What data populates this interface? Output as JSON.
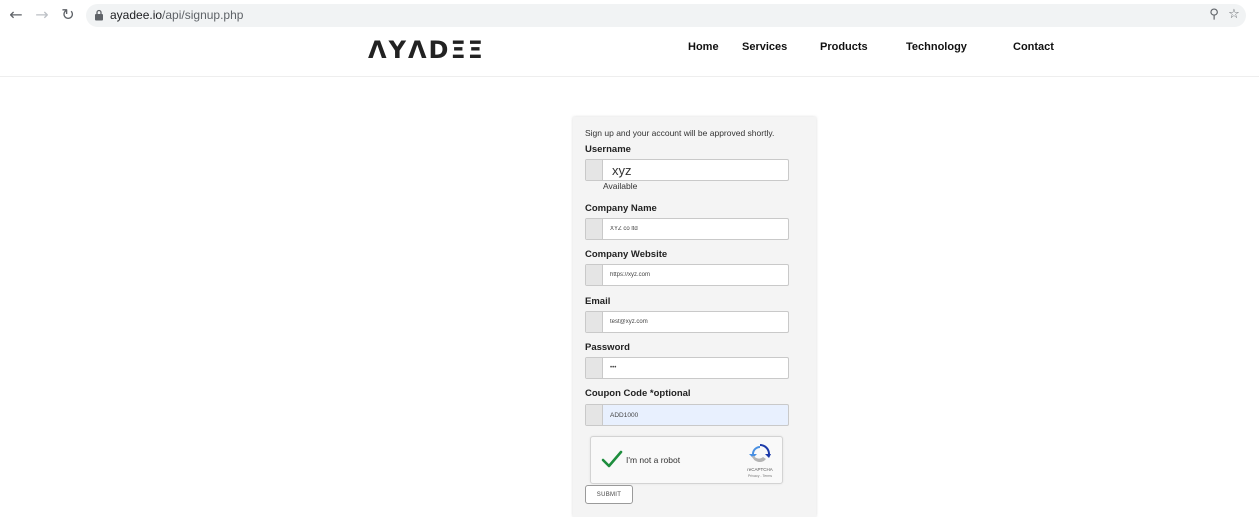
{
  "browser": {
    "url_host": "ayadee.io",
    "url_path": "/api/signup.php",
    "back_icon": "arrow-left-icon",
    "forward_icon": "arrow-right-icon",
    "reload_icon": "reload-icon"
  },
  "header": {
    "logo": "ΛYΛDΞΞ",
    "nav": [
      "Home",
      "Services",
      "Products",
      "Technology",
      "Contact"
    ]
  },
  "form": {
    "intro": "Sign up and your account will be approved shortly.",
    "username": {
      "label": "Username",
      "value": "xyz",
      "status": "Available"
    },
    "company_name": {
      "label": "Company Name",
      "value": "XYZ co ltd"
    },
    "company_website": {
      "label": "Company Website",
      "value": "https://xyz.com"
    },
    "email": {
      "label": "Email",
      "value": "test@xyz.com"
    },
    "password": {
      "label": "Password",
      "value": "•••"
    },
    "coupon": {
      "label": "Coupon Code *optional",
      "value": "ADD1000"
    },
    "recaptcha": {
      "checkbox_label": "I'm not a robot",
      "brand": "reCAPTCHA",
      "terms": "Privacy - Terms"
    },
    "submit_label": "SUBMIT"
  },
  "colors": {
    "accent_check": "#1e8e3e",
    "autofill_bg": "#e8f0fe"
  }
}
